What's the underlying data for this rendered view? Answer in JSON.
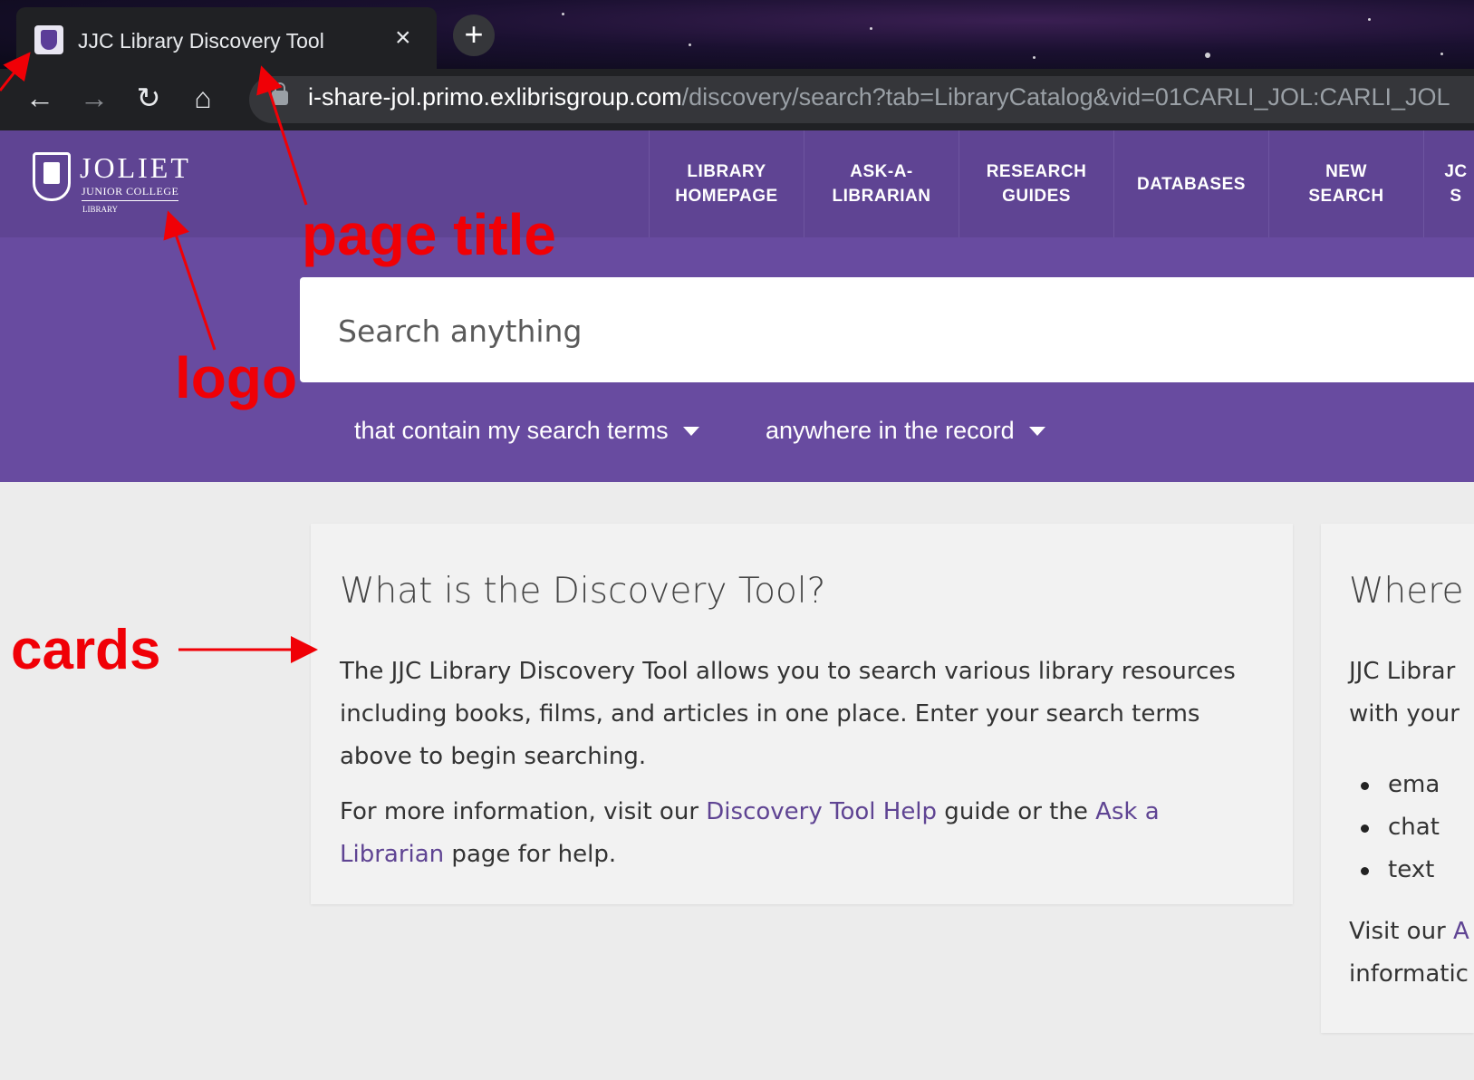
{
  "browser": {
    "tab_title": "JJC Library Discovery Tool",
    "tab_close": "×",
    "new_tab": "+",
    "url_host": "i-share-jol.primo.exlibrisgroup.com",
    "url_path": "/discovery/search?tab=LibraryCatalog&vid=01CARLI_JOL:CARLI_JOL",
    "icons": [
      "favicon-icon",
      "back-icon",
      "forward-icon",
      "reload-icon",
      "home-icon",
      "lock-icon"
    ]
  },
  "logo": {
    "word": "JOLIET",
    "sub": "JUNIOR COLLEGE",
    "lib": "LIBRARY"
  },
  "nav": {
    "items": [
      {
        "label": "LIBRARY HOMEPAGE"
      },
      {
        "label": "ASK-A-LIBRARIAN"
      },
      {
        "label": "RESEARCH GUIDES"
      },
      {
        "label": "DATABASES"
      },
      {
        "label": "NEW SEARCH"
      },
      {
        "label": "JC S"
      }
    ]
  },
  "search": {
    "placeholder": "Search anything",
    "filter_1": "that contain my search terms",
    "filter_2": "anywhere in the record"
  },
  "card1": {
    "title": "What is the Discovery Tool?",
    "p1": "The JJC Library Discovery Tool allows you to search various library resources including books, films, and articles in one place. Enter your search terms above to begin searching.",
    "p2_pre": "For more information, visit our ",
    "p2_link1": "Discovery Tool Help",
    "p2_mid": " guide or the ",
    "p2_link2": "Ask a Librarian",
    "p2_post": " page for help."
  },
  "card2": {
    "title": "Where c",
    "line1": "JJC Librar",
    "line2": "with your",
    "bullets": [
      "ema",
      "chat",
      "text"
    ],
    "visit_pre": "Visit our ",
    "visit_link": "A",
    "visit_line2": "informatic"
  },
  "annotations": {
    "page_title": "page title",
    "logo": "logo",
    "cards": "cards",
    "color": "#f00006"
  },
  "colors": {
    "header": "#5f4493",
    "search_band": "#684ba0",
    "link": "#5f4493"
  }
}
